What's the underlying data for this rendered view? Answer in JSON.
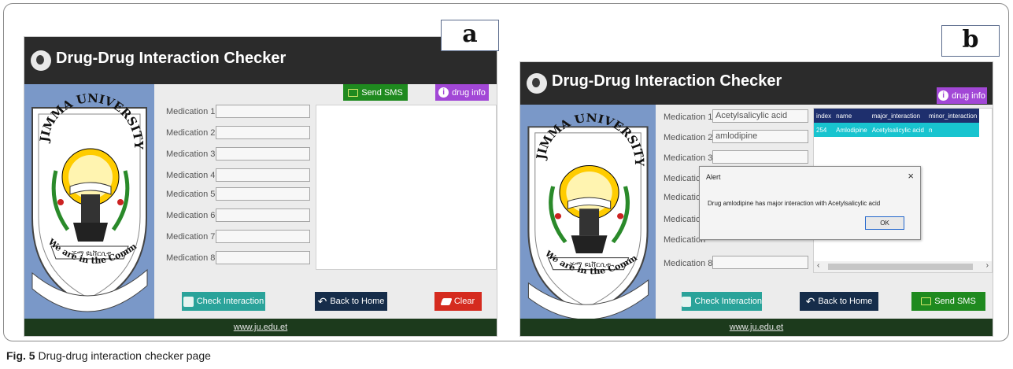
{
  "panel_a": {
    "tag": "a",
    "app_title": "Drug-Drug Interaction Checker",
    "buttons": {
      "send_sms": "Send SMS",
      "drug_info": "drug info",
      "check_interaction": "Check Interaction",
      "back_to_home": "Back to Home",
      "clear": "Clear"
    },
    "fields": [
      {
        "label": "Medication 1",
        "value": ""
      },
      {
        "label": "Medication 2",
        "value": ""
      },
      {
        "label": "Medication 3",
        "value": ""
      },
      {
        "label": "Medication 4",
        "value": ""
      },
      {
        "label": "Medication 5",
        "value": ""
      },
      {
        "label": "Medication 6",
        "value": ""
      },
      {
        "label": "Medication 7",
        "value": ""
      },
      {
        "label": "Medication 8",
        "value": ""
      }
    ],
    "footer": "www.ju.edu.et"
  },
  "panel_b": {
    "tag": "b",
    "app_title": "Drug-Drug Interaction Checker",
    "buttons": {
      "drug_info": "drug info",
      "check_interaction": "Check Interaction",
      "back_to_home": "Back to Home",
      "send_sms": "Send SMS"
    },
    "fields": [
      {
        "label": "Medication 1",
        "value": "Acetylsalicylic acid"
      },
      {
        "label": "Medication 2",
        "value": "amlodipine"
      },
      {
        "label": "Medication 3",
        "value": ""
      },
      {
        "label": "Medication",
        "value": ""
      },
      {
        "label": "Medication",
        "value": ""
      },
      {
        "label": "Medication",
        "value": ""
      },
      {
        "label": "Medication",
        "value": ""
      },
      {
        "label": "Medication 8",
        "value": ""
      }
    ],
    "table": {
      "headers": [
        "index",
        "name",
        "major_interaction",
        "minor_interaction"
      ],
      "rows": [
        [
          "254",
          "Amlodipine",
          "Acetylsalicylic acid",
          "n"
        ]
      ]
    },
    "alert": {
      "title": "Alert",
      "close": "×",
      "message": "Drug amlodipine has major interaction with Acetylsalicylic acid",
      "ok": "OK"
    },
    "footer": "www.ju.edu.et"
  },
  "university": {
    "name_arc": "JIMMA UNIVERSITY",
    "amharic": "ጅማ ዩኒቨርሲቲ",
    "motto": "We are in the Community"
  },
  "caption": {
    "label": "Fig. 5",
    "text": "Drug-drug interaction checker page"
  },
  "colors": {
    "sidebar": "#7a98c8",
    "titlebar": "#2b2b2b",
    "send_sms": "#1f8a1f",
    "drug_info": "#a247d6",
    "check_interaction": "#2aa39a",
    "back_home": "#162d4a",
    "clear": "#d52b1f",
    "grid_row": "#18c4cf"
  }
}
